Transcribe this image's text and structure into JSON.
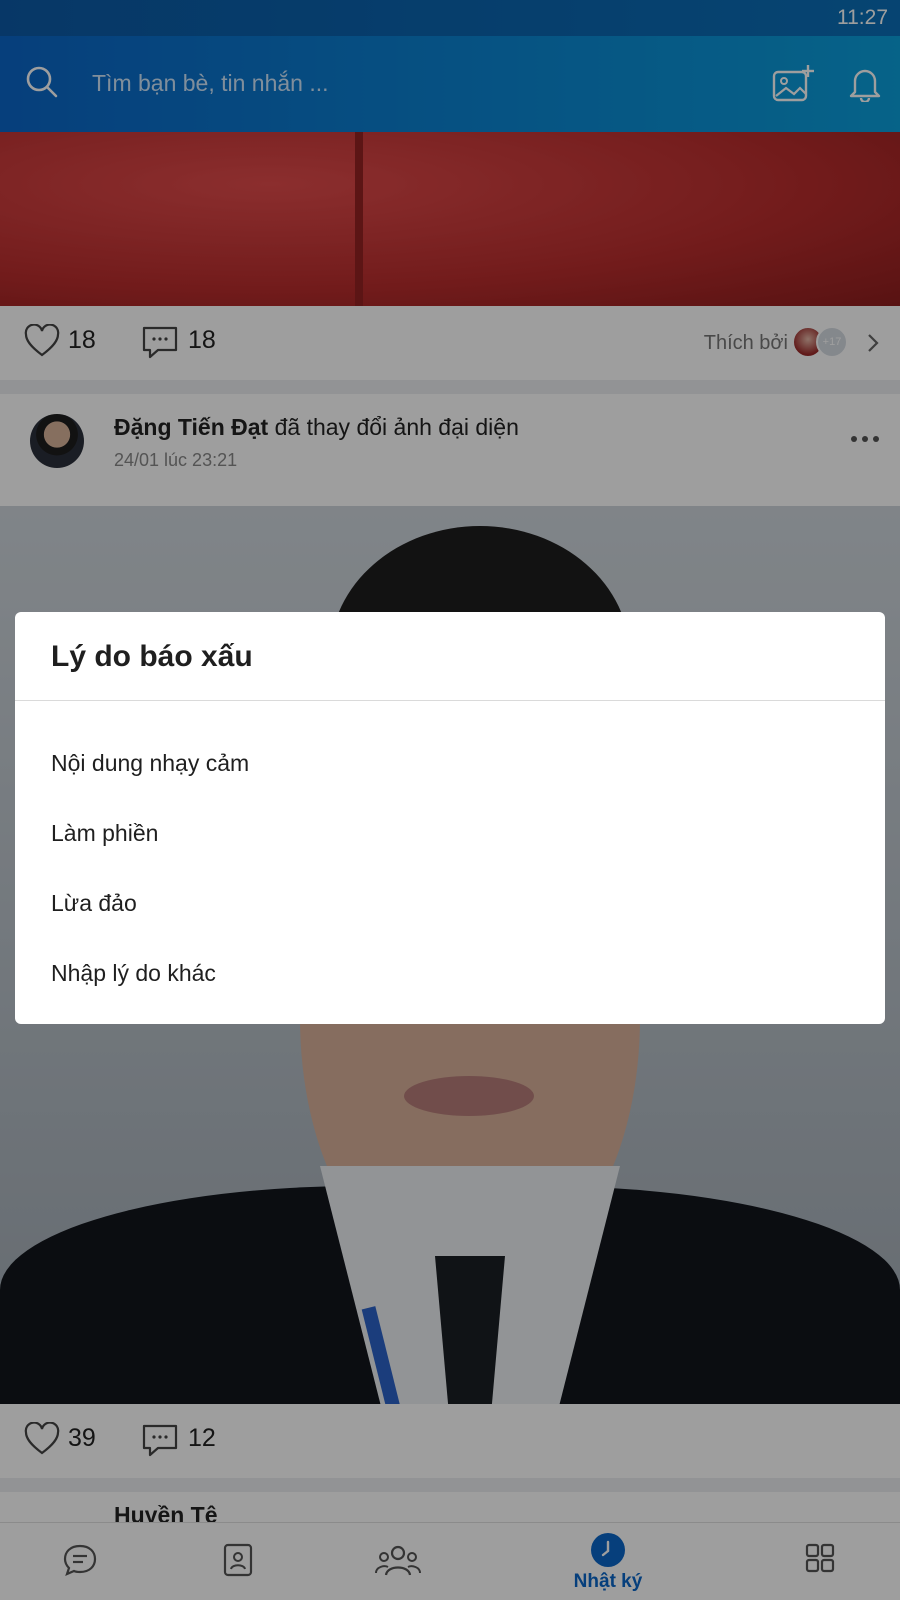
{
  "status_bar": {
    "time": "11:27"
  },
  "header": {
    "search_placeholder": "Tìm bạn bè, tin nhắn ...",
    "icons": [
      "search-icon",
      "add-photo-icon",
      "bell-icon"
    ]
  },
  "feed": {
    "post1": {
      "likes": "18",
      "comments": "18",
      "liked_by_label": "Thích bởi",
      "liked_by_more": "+17"
    },
    "post2": {
      "author": "Đặng Tiến Đạt",
      "action": "đã thay đổi ảnh đại diện",
      "time": "24/01 lúc 23:21",
      "likes": "39",
      "comments": "12"
    },
    "post3": {
      "author_partial": "Huyền Tê"
    }
  },
  "bottom_nav": {
    "items": [
      {
        "icon": "chat-icon",
        "label": ""
      },
      {
        "icon": "contacts-icon",
        "label": ""
      },
      {
        "icon": "groups-icon",
        "label": ""
      },
      {
        "icon": "clock-icon",
        "label": "Nhật ký",
        "active": true
      },
      {
        "icon": "grid-icon",
        "label": ""
      }
    ],
    "active_label": "Nhật ký"
  },
  "dialog": {
    "title": "Lý do báo xấu",
    "options": [
      "Nội dung nhạy cảm",
      "Làm phiền",
      "Lừa đảo",
      "Nhập lý do khác"
    ]
  },
  "colors": {
    "brand": "#0a66c8",
    "overlay": "rgba(0,0,0,0.38)"
  }
}
